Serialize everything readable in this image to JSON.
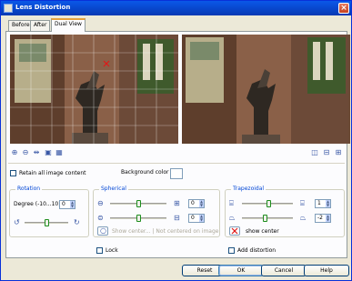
{
  "window": {
    "title": "Lens Distortion"
  },
  "tabs": [
    {
      "label": "Before"
    },
    {
      "label": "After"
    },
    {
      "label": "Dual View"
    }
  ],
  "toolbar": {
    "zoom_in_icon": "zoom-in-icon",
    "zoom_out_icon": "zoom-out-icon",
    "fit_icon": "fit-icon",
    "actual_size_icon": "actual-size-icon",
    "grid_icon": "grid-icon"
  },
  "options": {
    "retain_all_label": "Retain all image content",
    "background_color_label": "Background color"
  },
  "rotation": {
    "title": "Rotation",
    "degree_label": "Degree (-10...10)",
    "degree_value": "0",
    "slider_level": 0.5
  },
  "spherical": {
    "title": "Spherical",
    "horizontal_value": "0",
    "vertical_value": "0",
    "horizontal_level": 0.5,
    "vertical_level": 0.5,
    "show_center_text": "Show center... | Not centered on image",
    "lock_label": "Lock"
  },
  "trapezoidal": {
    "title": "Trapezoidal",
    "horizontal_value": "1",
    "vertical_value": "-2",
    "horizontal_level": 0.52,
    "vertical_level": 0.45,
    "show_center_label": "show center",
    "add_distortion_label": "Add distortion"
  },
  "buttons": {
    "reset": "Reset",
    "ok": "OK",
    "cancel": "Cancel",
    "help": "Help"
  }
}
